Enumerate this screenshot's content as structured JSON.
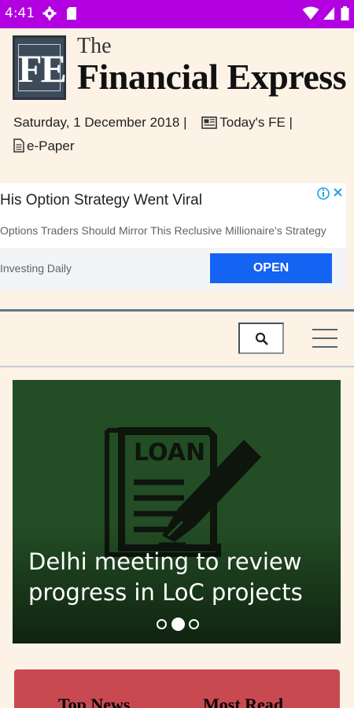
{
  "status_bar": {
    "time": "4:41",
    "icons": [
      "gear-icon",
      "sim-card-icon",
      "wifi-icon",
      "signal-icon",
      "battery-icon"
    ],
    "background": "#b200e0"
  },
  "masthead": {
    "logo_text": "FE",
    "the": "The",
    "title": "Financial Express"
  },
  "dateline": {
    "date": "Saturday, 1 December 2018 |",
    "todays_fe": "Today's FE |",
    "epaper": "e-Paper"
  },
  "ad": {
    "title": "His Option Strategy Went Viral",
    "description": "Options Traders Should Mirror This Reclusive Millionaire's Strategy",
    "source": "Investing Daily",
    "cta": "OPEN",
    "cta_color": "#1463f3"
  },
  "carousel": {
    "image_label": "LOAN",
    "headline": "Delhi meeting to review progress in LoC projects",
    "active_slide": 2,
    "slide_count": 3,
    "background": "#234d24"
  },
  "tabs": {
    "items": [
      "Top News",
      "Most Read"
    ],
    "background": "#c94951"
  }
}
